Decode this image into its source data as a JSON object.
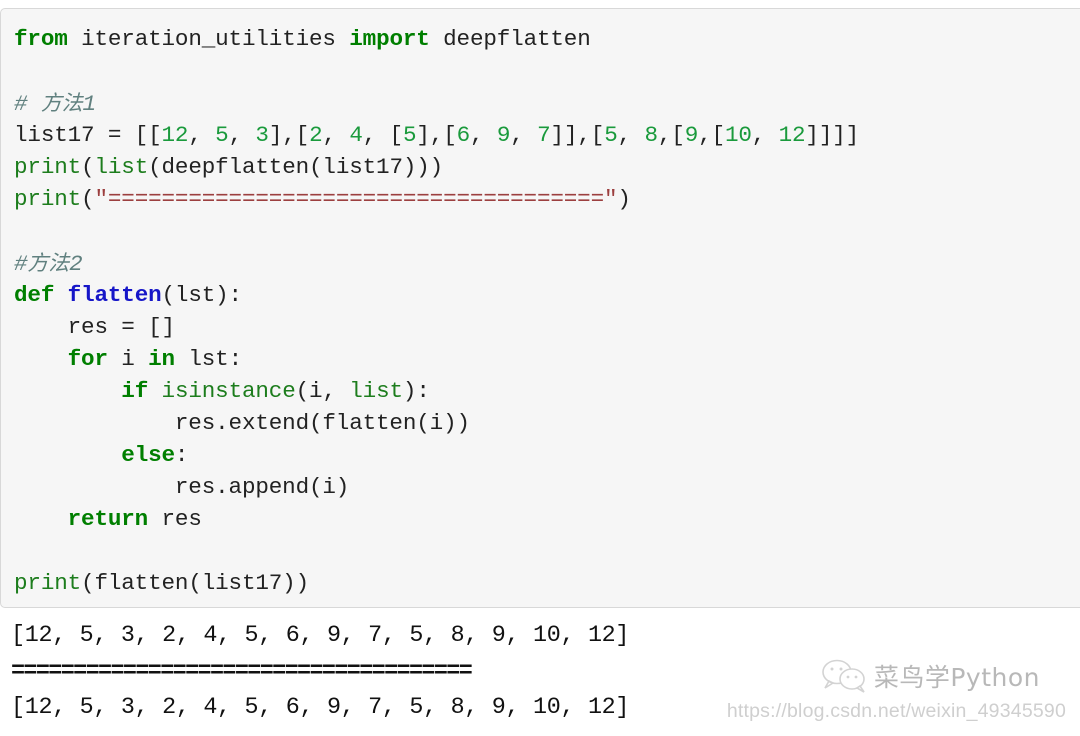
{
  "code_block": {
    "background": "#f6f6f6",
    "border_color": "#d8d8d8",
    "lines": [
      {
        "id": "l1",
        "text": "from iteration_utilities import deepflatten"
      },
      {
        "id": "l2",
        "text": ""
      },
      {
        "id": "l3",
        "text": "# 方法1"
      },
      {
        "id": "l4",
        "text": "list17 = [[12, 5, 3],[2, 4, [5],[6, 9, 7]],[5, 8,[9,[10, 12]]]]"
      },
      {
        "id": "l5",
        "text": "print(list(deepflatten(list17)))"
      },
      {
        "id": "l6",
        "text": "print(\"=====================================\")"
      },
      {
        "id": "l7",
        "text": ""
      },
      {
        "id": "l8",
        "text": "#方法2"
      },
      {
        "id": "l9",
        "text": "def flatten(lst):"
      },
      {
        "id": "l10",
        "text": "    res = []"
      },
      {
        "id": "l11",
        "text": "    for i in lst:"
      },
      {
        "id": "l12",
        "text": "        if isinstance(i, list):"
      },
      {
        "id": "l13",
        "text": "            res.extend(flatten(i))"
      },
      {
        "id": "l14",
        "text": "        else:"
      },
      {
        "id": "l15",
        "text": "            res.append(i)"
      },
      {
        "id": "l16",
        "text": "    return res"
      },
      {
        "id": "l17",
        "text": ""
      },
      {
        "id": "l18",
        "text": "print(flatten(list17))"
      }
    ],
    "tokens": {
      "l1": {
        "kw1": "from",
        "sp1": " ",
        "mod": "iteration_utilities",
        "sp2": " ",
        "kw2": "import",
        "sp3": " ",
        "name": "deepflatten"
      },
      "l3": {
        "hash": "# ",
        "cjk": "方法",
        "n": "1"
      },
      "l4": {
        "var": "list17 = [[",
        "n1": "12",
        "s1": ", ",
        "n2": "5",
        "s2": ", ",
        "n3": "3",
        "s3": "],[",
        "n4": "2",
        "s4": ", ",
        "n5": "4",
        "s5": ", [",
        "n6": "5",
        "s6": "],[",
        "n7": "6",
        "s7": ", ",
        "n8": "9",
        "s8": ", ",
        "n9": "7",
        "s9": "]],[",
        "n10": "5",
        "s10": ", ",
        "n11": "8",
        "s11": ",[",
        "n12": "9",
        "s12": ",[",
        "n13": "10",
        "s13": ", ",
        "n14": "12",
        "s14": "]]]]"
      },
      "l5": {
        "p": "print",
        "o1": "(",
        "li": "list",
        "o2": "(deepflatten(list17)))"
      },
      "l6": {
        "p": "print",
        "o1": "(",
        "str": "\"=====================================\"",
        "o2": ")"
      },
      "l8": {
        "hash": "#",
        "cjk": "方法",
        "n": "2"
      },
      "l9": {
        "kw": "def",
        "sp": " ",
        "fn": "flatten",
        "rest": "(lst):"
      },
      "l10": {
        "text": "    res = []"
      },
      "l11": {
        "ind": "    ",
        "kw1": "for",
        "mid": " i ",
        "kw2": "in",
        "rest": " lst:"
      },
      "l12": {
        "ind": "        ",
        "kw": "if",
        "sp": " ",
        "bi1": "isinstance",
        "o1": "(i, ",
        "bi2": "list",
        "o2": "):"
      },
      "l13": {
        "text": "            res.extend(flatten(i))"
      },
      "l14": {
        "ind": "        ",
        "kw": "else",
        "rest": ":"
      },
      "l15": {
        "text": "            res.append(i)"
      },
      "l16": {
        "ind": "    ",
        "kw": "return",
        "rest": " res"
      },
      "l18": {
        "p": "print",
        "rest": "(flatten(list17))"
      }
    }
  },
  "output": {
    "lines": [
      "[12, 5, 3, 2, 4, 5, 6, 9, 7, 5, 8, 9, 10, 12]",
      "=====================================",
      "[12, 5, 3, 2, 4, 5, 6, 9, 7, 5, 8, 9, 10, 12]"
    ]
  },
  "watermark": {
    "brand": "菜鸟学Python",
    "url": "https://blog.csdn.net/weixin_49345590",
    "logo_icon": "wechat-icon"
  },
  "colors": {
    "keyword": "#007f00",
    "builtin": "#1d7d1d",
    "function": "#1616c8",
    "number": "#1a9a3c",
    "string": "#9c3f3f",
    "comment": "#60807f",
    "plain": "#222222"
  }
}
